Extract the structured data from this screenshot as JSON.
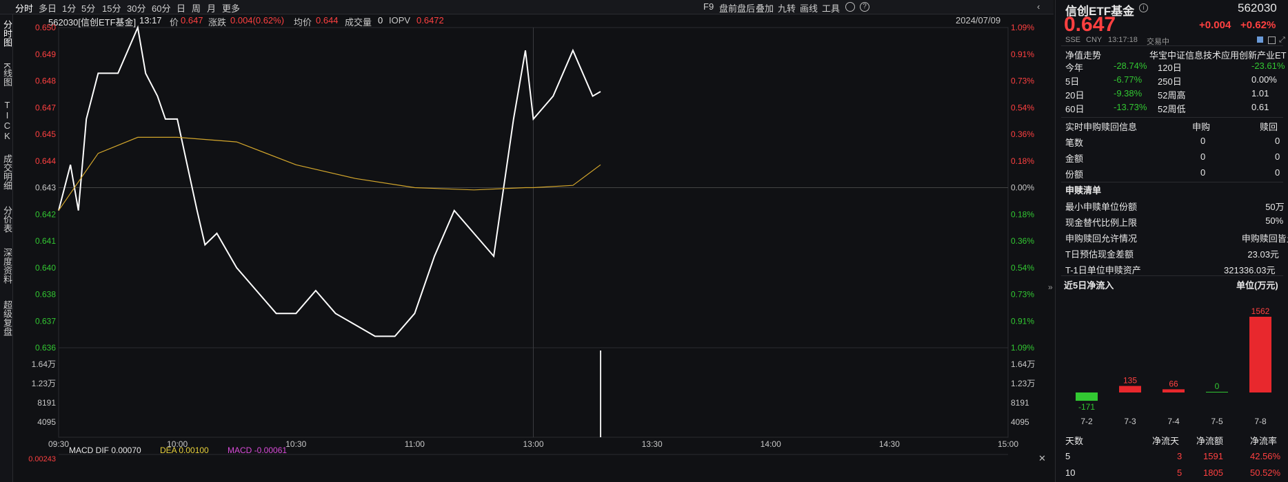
{
  "toolbar": {
    "left": [
      "分时",
      "多日",
      "1分",
      "5分",
      "15分",
      "30分",
      "60分",
      "日",
      "周",
      "月",
      "更多"
    ],
    "right": [
      "F9",
      "盘前盘后",
      "叠加",
      "九转",
      "画线",
      "工具"
    ]
  },
  "side_tabs": [
    "分时图",
    "K线图",
    "TICK",
    "成交明细",
    "分价表",
    "深度资料",
    "超级复盘"
  ],
  "info": {
    "code_name": "562030[信创ETF基金]",
    "time": "13:17",
    "price_label": "价",
    "price": "0.647",
    "change_label": "涨跌",
    "change": "0.004(0.62%)",
    "avg_label": "均价",
    "avg": "0.644",
    "vol_label": "成交量",
    "vol": "0",
    "iopv_label": "IOPV",
    "iopv": "0.6472",
    "date": "2024/07/09"
  },
  "price_axis": {
    "left": [
      "0.650",
      "0.649",
      "0.648",
      "0.647",
      "0.645",
      "0.644",
      "0.643",
      "0.642",
      "0.641",
      "0.640",
      "0.638",
      "0.637",
      "0.636"
    ],
    "right": [
      "1.09%",
      "0.91%",
      "0.73%",
      "0.54%",
      "0.36%",
      "0.18%",
      "0.00%",
      "0.18%",
      "0.36%",
      "0.54%",
      "0.73%",
      "0.91%",
      "1.09%"
    ]
  },
  "vol_axis": [
    "1.64万",
    "1.23万",
    "8191",
    "4095"
  ],
  "vol_axis_top": "1.64万",
  "time_axis": [
    "09:30",
    "10:00",
    "10:30",
    "11:00",
    "13:00",
    "13:30",
    "14:00",
    "14:30",
    "15:00"
  ],
  "macd": {
    "title": "MACD",
    "dif_label": "DIF",
    "dif": "0.00070",
    "dea_label": "DEA",
    "dea": "0.00100",
    "macd_label": "MACD",
    "macd": "-0.00061",
    "axis_top": "0.00243"
  },
  "colors": {
    "up": "#ff4040",
    "down": "#32c832",
    "price_line": "#ffffff",
    "avg_line": "#d4a72c",
    "iopv_line": "#e07070"
  },
  "chart_data": {
    "type": "line",
    "title": "562030[信创ETF基金]",
    "xlabel": "",
    "ylabel": "",
    "ylim": [
      0.636,
      0.65
    ],
    "prev_close": 0.643,
    "series": [
      {
        "name": "价",
        "x": [
          "09:30",
          "09:33",
          "09:35",
          "09:37",
          "09:40",
          "09:45",
          "09:50",
          "09:52",
          "09:55",
          "09:57",
          "10:00",
          "10:05",
          "10:07",
          "10:10",
          "10:15",
          "10:20",
          "10:25",
          "10:30",
          "10:35",
          "10:40",
          "10:45",
          "10:50",
          "10:55",
          "11:00",
          "11:05",
          "11:10",
          "11:15",
          "11:20",
          "11:25",
          "11:28",
          "13:00",
          "13:05",
          "13:10",
          "13:15",
          "13:17"
        ],
        "y": [
          0.642,
          0.644,
          0.642,
          0.646,
          0.648,
          0.648,
          0.65,
          0.648,
          0.647,
          0.646,
          0.646,
          0.642,
          0.6405,
          0.641,
          0.6395,
          0.6385,
          0.6375,
          0.6375,
          0.6385,
          0.6375,
          0.637,
          0.6365,
          0.6365,
          0.6375,
          0.64,
          0.642,
          0.641,
          0.64,
          0.646,
          0.649,
          0.646,
          0.647,
          0.649,
          0.647,
          0.6472
        ]
      },
      {
        "name": "均价",
        "x": [
          "09:30",
          "09:40",
          "09:50",
          "10:00",
          "10:15",
          "10:30",
          "10:45",
          "11:00",
          "11:15",
          "11:28",
          "13:00",
          "13:10",
          "13:17"
        ],
        "y": [
          0.642,
          0.6445,
          0.6452,
          0.6452,
          0.645,
          0.644,
          0.6434,
          0.643,
          0.6429,
          0.643,
          0.643,
          0.6431,
          0.644
        ]
      }
    ]
  },
  "right_panel": {
    "name": "信创ETF基金",
    "code": "562030",
    "price": "0.647",
    "change": "+0.004",
    "change_pct": "+0.62%",
    "meta": [
      "SSE",
      "CNY",
      "13:17:18",
      "交易中"
    ],
    "nav_label": "净值走势",
    "index_name": "华宝中证信息技术应用创新产业ET",
    "perf": [
      [
        "今年",
        "-28.74%",
        "120日",
        "-23.61%"
      ],
      [
        "5日",
        "-6.77%",
        "250日",
        "0.00%"
      ],
      [
        "20日",
        "-9.38%",
        "52周高",
        "1.01"
      ],
      [
        "60日",
        "-13.73%",
        "52周低",
        "0.61"
      ]
    ],
    "redeem_header": [
      "实时申购赎回信息",
      "申购",
      "赎回"
    ],
    "redeem_rows": [
      [
        "笔数",
        "0",
        "0"
      ],
      [
        "金额",
        "0",
        "0"
      ],
      [
        "份额",
        "0",
        "0"
      ]
    ],
    "list_title": "申赎清单",
    "list_rows": [
      [
        "最小申赎单位份额",
        "50万"
      ],
      [
        "现金替代比例上限",
        "50%"
      ],
      [
        "申购赎回允许情况",
        "申购赎回皆允许"
      ],
      [
        "T日预估现金差额",
        "23.03元"
      ],
      [
        "T-1日单位申赎资产",
        "321336.03元"
      ]
    ],
    "flow_title": "近5日净流入",
    "flow_unit": "单位(万元)",
    "flow_chart": {
      "type": "bar",
      "categories": [
        "7-2",
        "7-3",
        "7-4",
        "7-5",
        "7-8"
      ],
      "values": [
        -171,
        135,
        66,
        0,
        1562
      ]
    },
    "stats_header": [
      "天数",
      "净流天",
      "净流额",
      "净流率"
    ],
    "stats_rows": [
      [
        "5",
        "3",
        "1591",
        "42.56%"
      ],
      [
        "10",
        "5",
        "1805",
        "50.52%"
      ]
    ]
  }
}
